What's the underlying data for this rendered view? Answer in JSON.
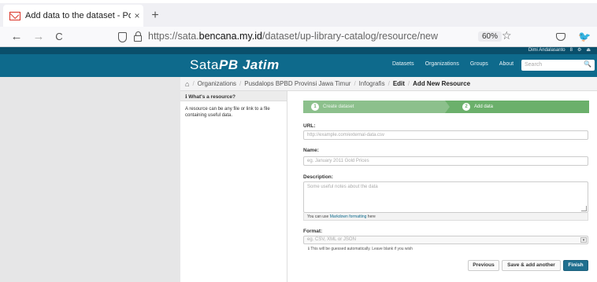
{
  "browser": {
    "tab_title": "Add data to the dataset - Portal",
    "tab_close": "×",
    "new_tab": "+",
    "back": "←",
    "forward": "→",
    "reload": "C",
    "url_prefix": "https://sata.",
    "url_domain": "bencana.my.id",
    "url_path": "/dataset/up-library-catalog/resource/new",
    "zoom": "60%",
    "star": "☆",
    "extension": "🐦"
  },
  "site": {
    "account_items": [
      "Dimi Andalasanto",
      "8",
      "⚙",
      "⏏"
    ],
    "brand_prefix": "Sata",
    "brand_suffix": "PB Jatim",
    "nav": [
      "Datasets",
      "Organizations",
      "Groups",
      "About"
    ],
    "search_placeholder": "Search",
    "search_icon": "🔍"
  },
  "breadcrumb": {
    "home": "⌂",
    "items": [
      "Organizations",
      "Pusdalops BPBD Provinsi Jawa Timur",
      "Infografis",
      "Edit",
      "Add New Resource"
    ],
    "separator": "/"
  },
  "sidebar": {
    "heading": "ℹ What's a resource?",
    "body": "A resource can be any file or link to a file containing useful data."
  },
  "form": {
    "stage1": {
      "num": "1",
      "label": "Create dataset"
    },
    "stage2": {
      "num": "2",
      "label": "Add data"
    },
    "url_label": "URL:",
    "url_placeholder": "http://example.com/external-data.csv",
    "name_label": "Name:",
    "name_placeholder": "eg. January 2011 Gold Prices",
    "desc_label": "Description:",
    "desc_placeholder": "Some useful notes about the data",
    "markdown_hint_pre": "You can use ",
    "markdown_hint_link": "Markdown formatting",
    "markdown_hint_post": " here",
    "format_label": "Format:",
    "format_placeholder": "eg. CSV, XML or JSON",
    "format_note": "ℹ This will be guessed automatically. Leave blank if you wish",
    "btn_previous": "Previous",
    "btn_save_add": "Save & add another",
    "btn_finish": "Finish"
  }
}
